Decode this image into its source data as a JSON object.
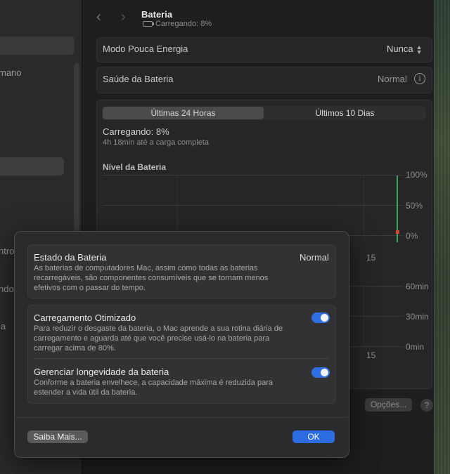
{
  "window": {
    "title": "Bateria",
    "subtitle": "Carregando: 8%"
  },
  "sidebar": {
    "fragments": [
      "mano",
      "ntro",
      "ndo",
      "la"
    ]
  },
  "settings": {
    "low_power": {
      "label": "Modo Pouca Energia",
      "value": "Nunca"
    },
    "health": {
      "label": "Saúde da Bateria",
      "value": "Normal"
    }
  },
  "tabs": [
    {
      "label": "Últimas 24 Horas",
      "active": true
    },
    {
      "label": "Últimos 10 Dias",
      "active": false
    }
  ],
  "charging": {
    "status": "Carregando: 8%",
    "eta": "4h 18min até a carga completa"
  },
  "level_chart": {
    "title": "Nível da Bateria",
    "ticks": [
      "100%",
      "50%",
      "0%"
    ],
    "x_label": "15"
  },
  "usage_chart": {
    "ticks": [
      "60min",
      "30min",
      "0min"
    ],
    "x_label": "15"
  },
  "modal": {
    "battery_state": {
      "title": "Estado da Bateria",
      "value": "Normal",
      "description": "As baterias de computadores Mac, assim como todas as baterias recarregáveis, são componentes consumíveis que se tornam menos efetivos com o passar do tempo."
    },
    "optimized_charging": {
      "title": "Carregamento Otimizado",
      "description": "Para reduzir o desgaste da bateria, o Mac aprende a sua rotina diária de carregamento e aguarda até que você precise usá-lo na bateria para carregar acima de 80%.",
      "enabled": true
    },
    "longevity": {
      "title": "Gerenciar longevidade da bateria",
      "description": "Conforme a bateria envelhece, a capacidade máxima é reduzida para estender a vida útil da bateria.",
      "enabled": true
    },
    "learn_more_label": "Saiba Mais...",
    "ok_label": "OK"
  },
  "background_buttons": {
    "options_label": "Opções...",
    "help_label": "?"
  },
  "colors": {
    "accent": "#2d6be0",
    "chart_line": "#3aa55a",
    "chart_marker": "#d44a3a"
  }
}
